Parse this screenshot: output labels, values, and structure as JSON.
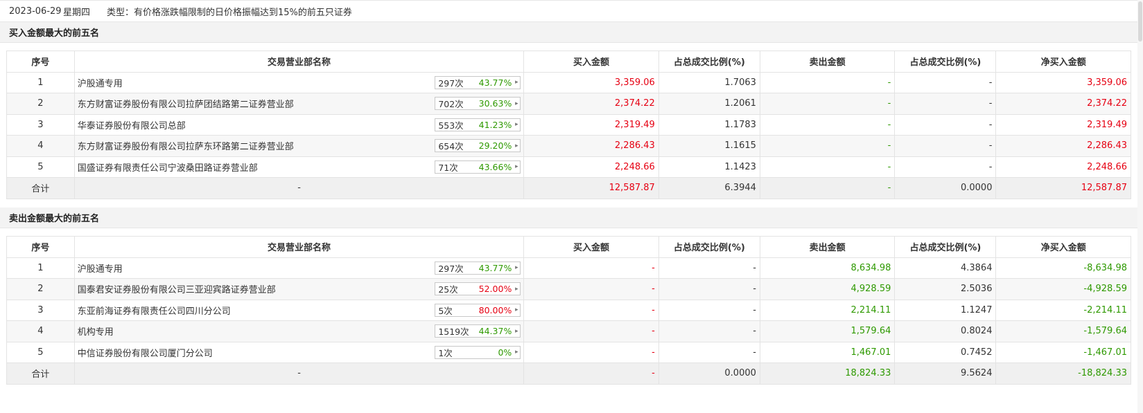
{
  "header": {
    "date": "2023-06-29",
    "weekday": "星期四",
    "type_label": "类型：有价格涨跌幅限制的日价格振幅达到15%的前五只证券"
  },
  "columns": {
    "seq": "序号",
    "name": "交易营业部名称",
    "buy": "买入金额",
    "buy_pct": "占总成交比例(%)",
    "sell": "卖出金额",
    "sell_pct": "占总成交比例(%)",
    "net": "净买入金额"
  },
  "colors": {
    "up": "#e60012",
    "down": "#2e9900"
  },
  "buy_section": {
    "title": "买入金额最大的前五名",
    "rows": [
      {
        "seq": "1",
        "name": "沪股通专用",
        "count": "297次",
        "rate": "43.77%",
        "buy": "3,359.06",
        "buy_pct": "1.7063",
        "sell": "-",
        "sell_pct": "-",
        "net": "3,359.06"
      },
      {
        "seq": "2",
        "name": "东方财富证券股份有限公司拉萨团结路第二证券营业部",
        "count": "702次",
        "rate": "30.63%",
        "buy": "2,374.22",
        "buy_pct": "1.2061",
        "sell": "-",
        "sell_pct": "-",
        "net": "2,374.22"
      },
      {
        "seq": "3",
        "name": "华泰证券股份有限公司总部",
        "count": "553次",
        "rate": "41.23%",
        "buy": "2,319.49",
        "buy_pct": "1.1783",
        "sell": "-",
        "sell_pct": "-",
        "net": "2,319.49"
      },
      {
        "seq": "4",
        "name": "东方财富证券股份有限公司拉萨东环路第二证券营业部",
        "count": "654次",
        "rate": "29.20%",
        "buy": "2,286.43",
        "buy_pct": "1.1615",
        "sell": "-",
        "sell_pct": "-",
        "net": "2,286.43"
      },
      {
        "seq": "5",
        "name": "国盛证券有限责任公司宁波桑田路证券营业部",
        "count": "71次",
        "rate": "43.66%",
        "buy": "2,248.66",
        "buy_pct": "1.1423",
        "sell": "-",
        "sell_pct": "-",
        "net": "2,248.66"
      }
    ],
    "total": {
      "label": "合计",
      "name": "-",
      "buy": "12,587.87",
      "buy_pct": "6.3944",
      "sell": "-",
      "sell_pct": "0.0000",
      "net": "12,587.87"
    }
  },
  "sell_section": {
    "title": "卖出金额最大的前五名",
    "rows": [
      {
        "seq": "1",
        "name": "沪股通专用",
        "count": "297次",
        "rate": "43.77%",
        "rate_color": "green",
        "buy": "-",
        "buy_pct": "-",
        "sell": "8,634.98",
        "sell_pct": "4.3864",
        "net": "-8,634.98"
      },
      {
        "seq": "2",
        "name": "国泰君安证券股份有限公司三亚迎宾路证券营业部",
        "count": "25次",
        "rate": "52.00%",
        "rate_color": "red",
        "buy": "-",
        "buy_pct": "-",
        "sell": "4,928.59",
        "sell_pct": "2.5036",
        "net": "-4,928.59"
      },
      {
        "seq": "3",
        "name": "东亚前海证券有限责任公司四川分公司",
        "count": "5次",
        "rate": "80.00%",
        "rate_color": "red",
        "buy": "-",
        "buy_pct": "-",
        "sell": "2,214.11",
        "sell_pct": "1.1247",
        "net": "-2,214.11"
      },
      {
        "seq": "4",
        "name": "机构专用",
        "count": "1519次",
        "rate": "44.37%",
        "rate_color": "green",
        "buy": "-",
        "buy_pct": "-",
        "sell": "1,579.64",
        "sell_pct": "0.8024",
        "net": "-1,579.64"
      },
      {
        "seq": "5",
        "name": "中信证券股份有限公司厦门分公司",
        "count": "1次",
        "rate": "0%",
        "rate_color": "green",
        "buy": "-",
        "buy_pct": "-",
        "sell": "1,467.01",
        "sell_pct": "0.7452",
        "net": "-1,467.01"
      }
    ],
    "total": {
      "label": "合计",
      "name": "-",
      "buy": "-",
      "buy_pct": "0.0000",
      "sell": "18,824.33",
      "sell_pct": "9.5624",
      "net": "-18,824.33"
    }
  },
  "icons": {
    "row_arrow": "chevron-right-icon"
  }
}
